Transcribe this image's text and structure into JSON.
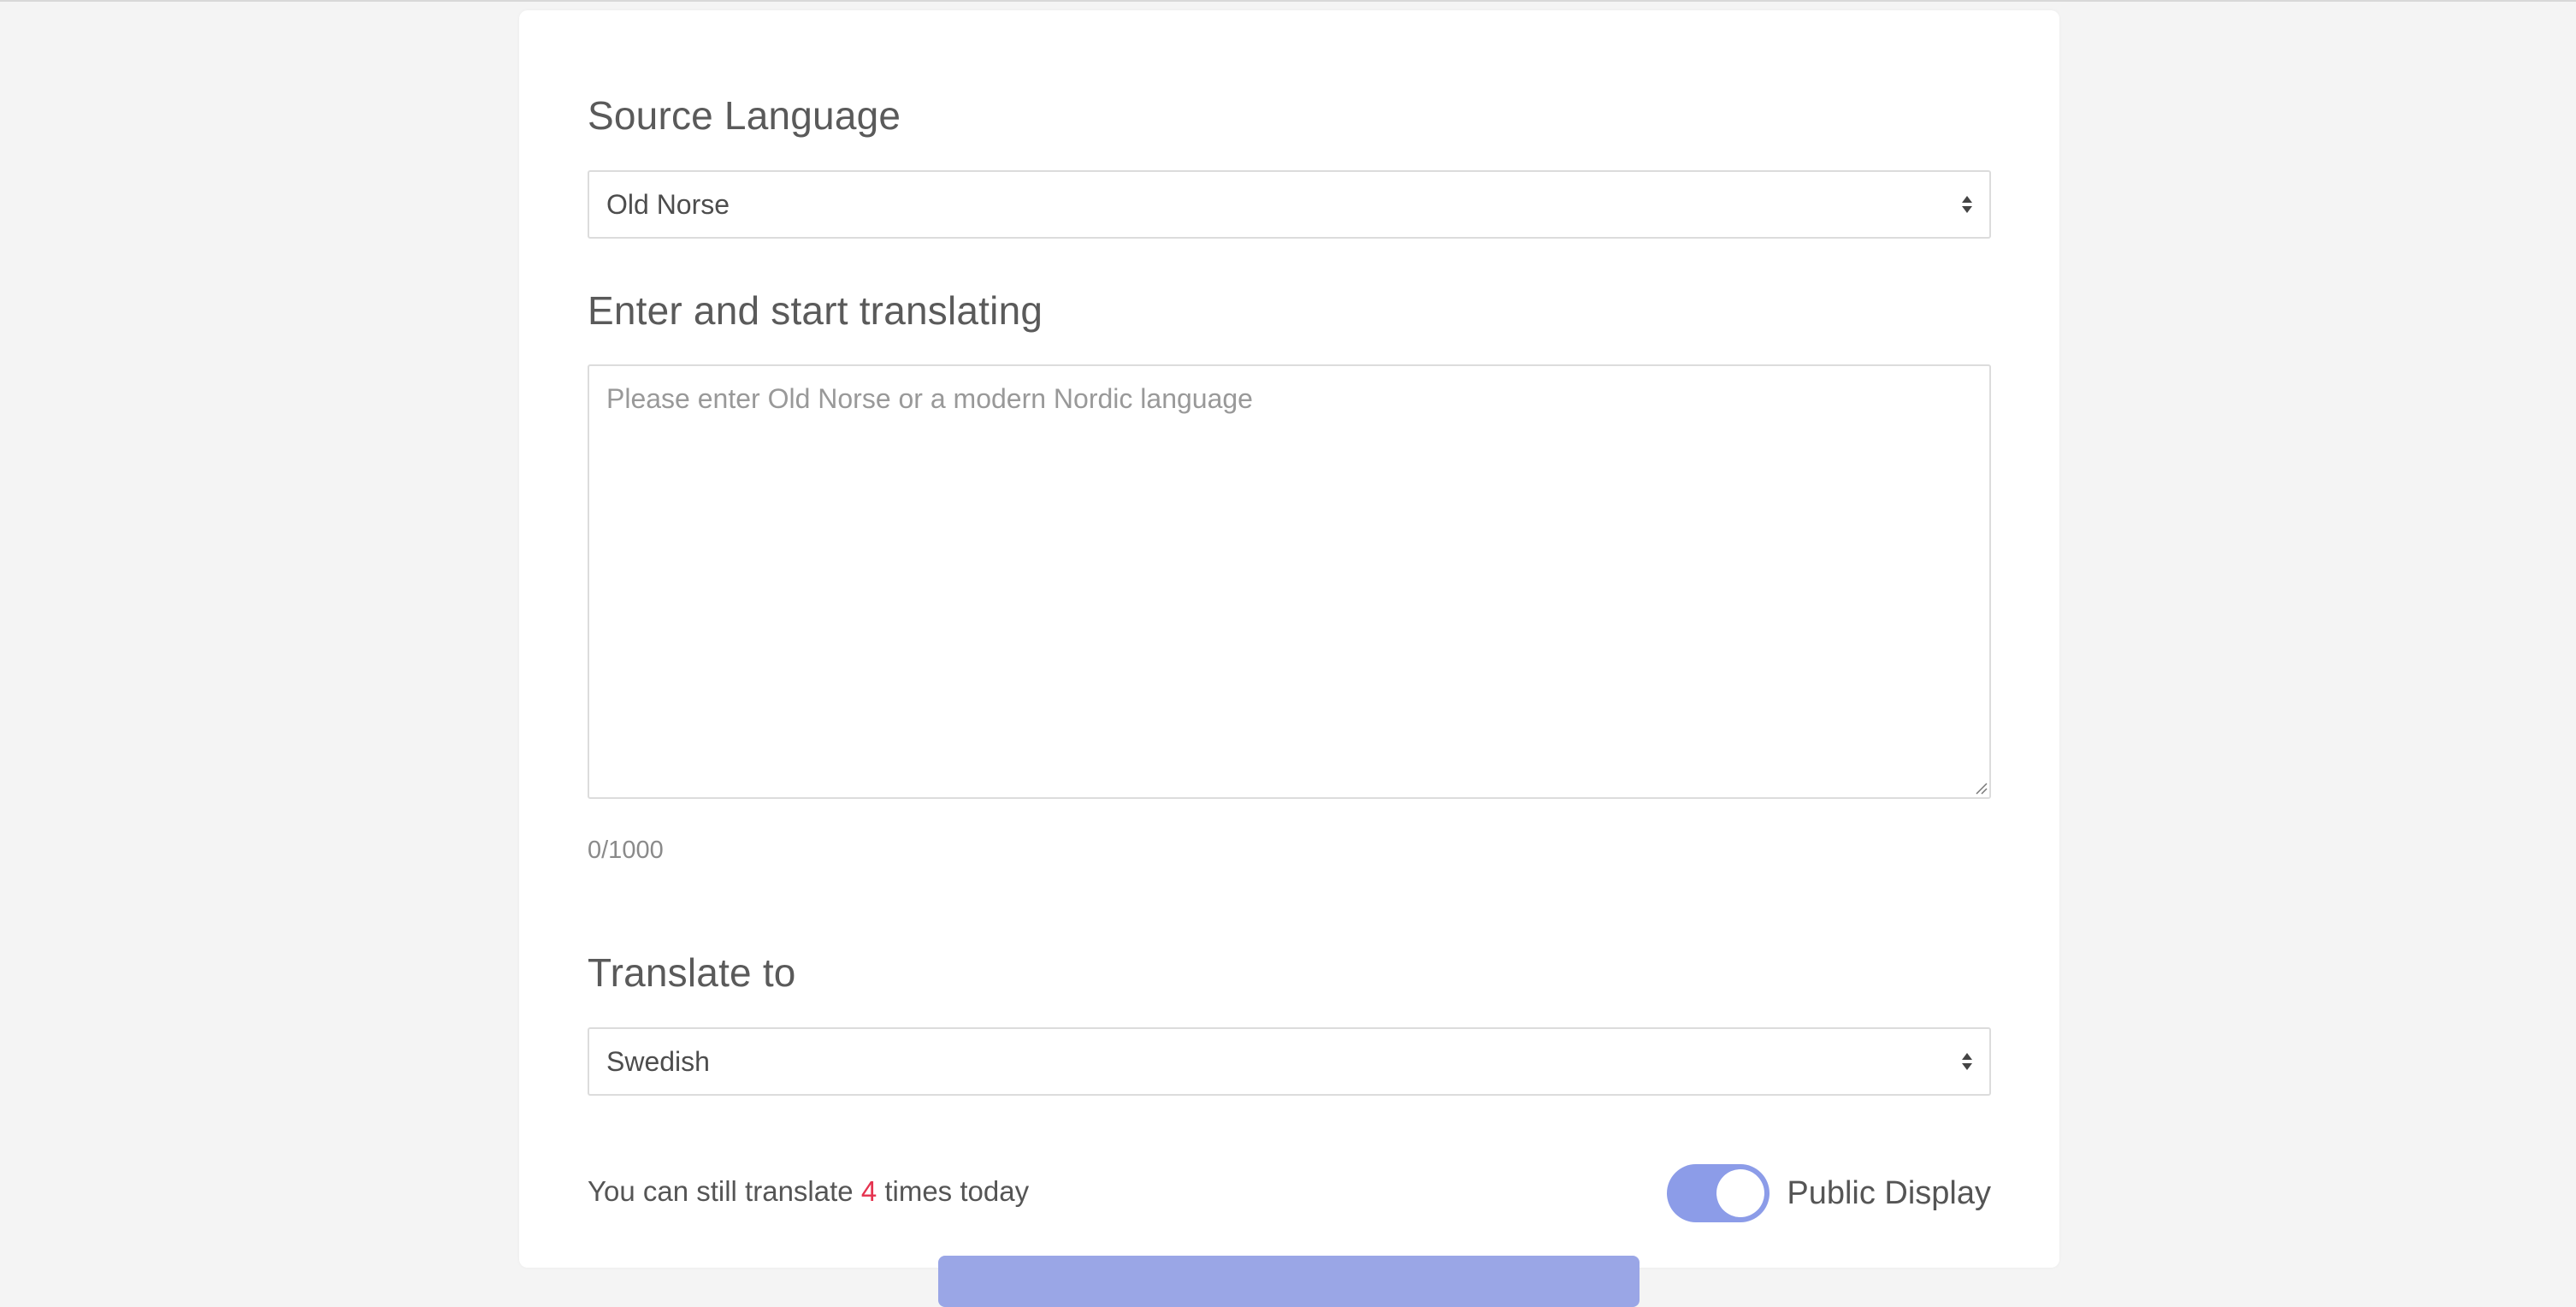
{
  "form": {
    "source_heading": "Source Language",
    "source_value": "Old Norse",
    "input_heading": "Enter and start translating",
    "input_placeholder": "Please enter Old Norse or a modern Nordic language",
    "char_count": "0/1000",
    "target_heading": "Translate to",
    "target_value": "Swedish",
    "quota_prefix": "You can still translate ",
    "quota_count": "4",
    "quota_suffix": " times today",
    "public_display_label": "Public Display",
    "public_display_on": true
  },
  "colors": {
    "accent": "#8c9ce8",
    "quota_number": "#e5334f"
  },
  "icons": {
    "select_arrows": "updown-arrows-icon",
    "resize": "resize-grip-icon"
  }
}
